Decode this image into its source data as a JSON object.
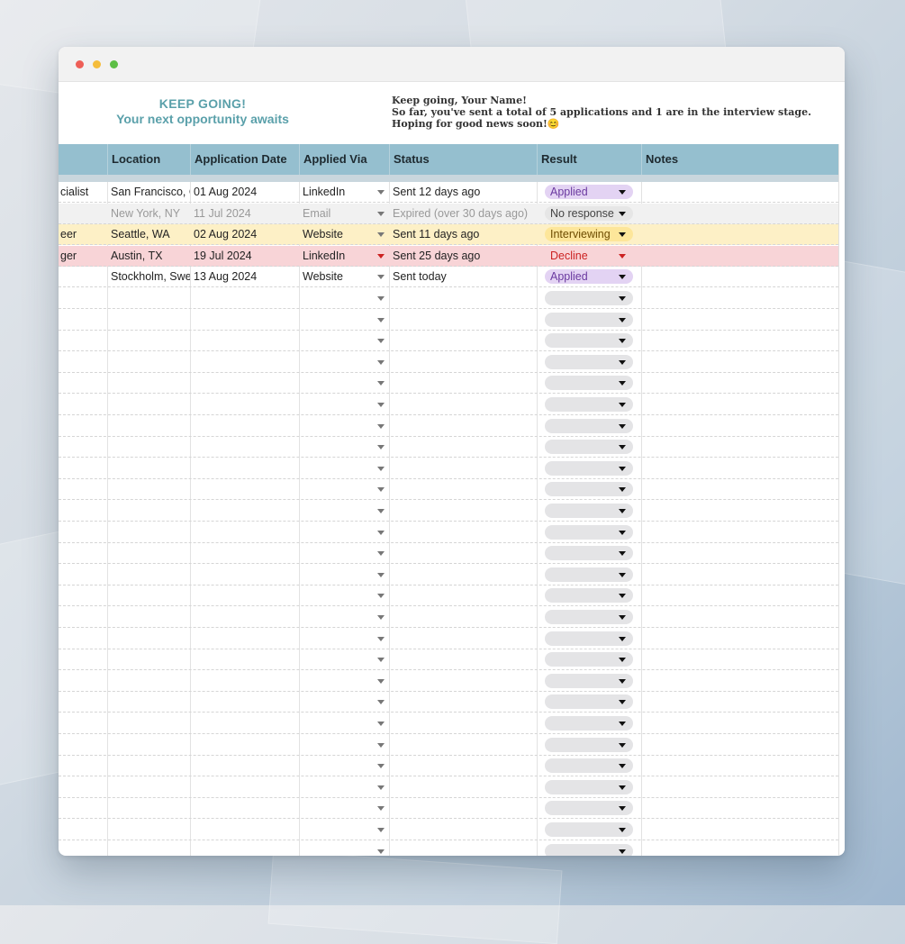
{
  "banner": {
    "headline": "KEEP GOING!",
    "subheadline": "Your next opportunity awaits",
    "greeting": "Keep going, Your Name!",
    "summary": "So far, you've sent a total of 5 applications and 1 are in the interview stage. Hoping for good news soon!😊"
  },
  "columns": {
    "location": "Location",
    "application_date": "Application Date",
    "applied_via": "Applied Via",
    "status": "Status",
    "result": "Result",
    "notes": "Notes"
  },
  "rows": [
    {
      "role": "cialist",
      "location": "San Francisco, C",
      "date": "01 Aug 2024",
      "via": "LinkedIn",
      "status": "Sent 12 days ago",
      "result": "Applied",
      "style": "normal"
    },
    {
      "role": "",
      "location": "New York, NY",
      "date": "11 Jul 2024",
      "via": "Email",
      "status": "Expired (over 30 days ago)",
      "result": "No response",
      "style": "expired"
    },
    {
      "role": "eer",
      "location": "Seattle, WA",
      "date": "02 Aug 2024",
      "via": "Website",
      "status": "Sent 11 days ago",
      "result": "Interviewing",
      "style": "interviewing"
    },
    {
      "role": "ger",
      "location": "Austin, TX",
      "date": "19 Jul 2024",
      "via": "LinkedIn",
      "status": "Sent 25 days ago",
      "result": "Decline",
      "style": "decline"
    },
    {
      "role": "",
      "location": "Stockholm, Swe",
      "date": "13 Aug 2024",
      "via": "Website",
      "status": "Sent today",
      "result": "Applied",
      "style": "normal"
    }
  ]
}
